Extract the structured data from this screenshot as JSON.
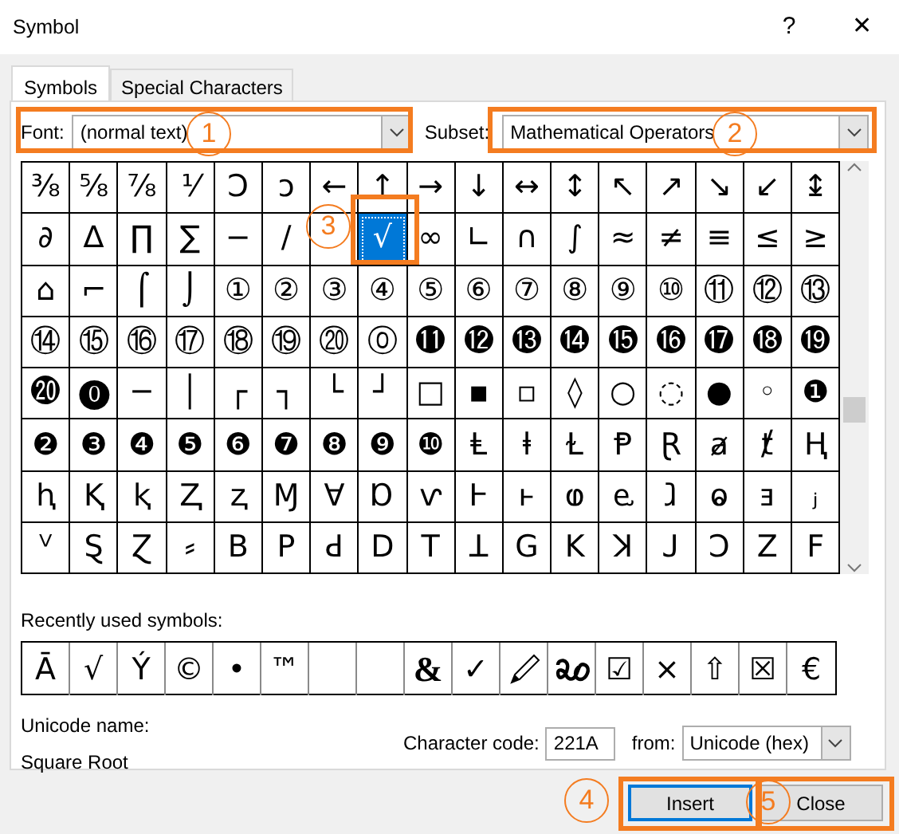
{
  "window": {
    "title": "Symbol",
    "help": "?",
    "close": "✕"
  },
  "tabs": [
    {
      "label": "Symbols",
      "selected": true
    },
    {
      "label": "Special Characters",
      "selected": false
    }
  ],
  "font": {
    "label": "Font:",
    "value": "(normal text)"
  },
  "subset": {
    "label": "Subset:",
    "value": "Mathematical Operators"
  },
  "grid": [
    [
      {
        "char": "⅜",
        "selected": false
      },
      {
        "char": "⅝",
        "selected": false
      },
      {
        "char": "⅞",
        "selected": false
      },
      {
        "char": "⅟",
        "selected": false
      },
      {
        "char": "Ↄ",
        "selected": false
      },
      {
        "char": "ↄ",
        "selected": false
      },
      {
        "char": "←",
        "selected": false
      },
      {
        "char": "↑",
        "selected": false
      },
      {
        "char": "→",
        "selected": false
      },
      {
        "char": "↓",
        "selected": false
      },
      {
        "char": "↔",
        "selected": false
      },
      {
        "char": "↕",
        "selected": false
      },
      {
        "char": "↖",
        "selected": false
      },
      {
        "char": "↗",
        "selected": false
      },
      {
        "char": "↘",
        "selected": false
      },
      {
        "char": "↙",
        "selected": false
      },
      {
        "char": "↨",
        "selected": false
      }
    ],
    [
      {
        "char": "∂",
        "selected": false
      },
      {
        "char": "∆",
        "selected": false
      },
      {
        "char": "∏",
        "selected": false
      },
      {
        "char": "∑",
        "selected": false
      },
      {
        "char": "−",
        "selected": false
      },
      {
        "char": "∕",
        "selected": false
      },
      {
        "selected": false
      },
      {
        "char": "√",
        "selected": true
      },
      {
        "char": "∞",
        "selected": false
      },
      {
        "char": "∟",
        "selected": false
      },
      {
        "char": "∩",
        "selected": false
      },
      {
        "char": "∫",
        "selected": false
      },
      {
        "char": "≈",
        "selected": false
      },
      {
        "char": "≠",
        "selected": false
      },
      {
        "char": "≡",
        "selected": false
      },
      {
        "char": "≤",
        "selected": false
      },
      {
        "char": "≥",
        "selected": false
      }
    ],
    [
      {
        "char": "⌂",
        "selected": false
      },
      {
        "char": "⌐",
        "selected": false
      },
      {
        "char": "⌠",
        "selected": false
      },
      {
        "char": "⌡",
        "selected": false
      },
      {
        "char": "①",
        "selected": false
      },
      {
        "char": "②",
        "selected": false
      },
      {
        "char": "③",
        "selected": false
      },
      {
        "char": "④",
        "selected": false
      },
      {
        "char": "⑤",
        "selected": false
      },
      {
        "char": "⑥",
        "selected": false
      },
      {
        "char": "⑦",
        "selected": false
      },
      {
        "char": "⑧",
        "selected": false
      },
      {
        "char": "⑨",
        "selected": false
      },
      {
        "char": "⑩",
        "selected": false
      },
      {
        "char": "⑪",
        "selected": false
      },
      {
        "char": "⑫",
        "selected": false
      },
      {
        "char": "⑬",
        "selected": false
      }
    ],
    [
      {
        "char": "⑭",
        "selected": false
      },
      {
        "char": "⑮",
        "selected": false
      },
      {
        "char": "⑯",
        "selected": false
      },
      {
        "char": "⑰",
        "selected": false
      },
      {
        "char": "⑱",
        "selected": false
      },
      {
        "char": "⑲",
        "selected": false
      },
      {
        "char": "⑳",
        "selected": false
      },
      {
        "char": "⓪",
        "selected": false
      },
      {
        "char": "⓫",
        "selected": false
      },
      {
        "char": "⓬",
        "selected": false
      },
      {
        "char": "⓭",
        "selected": false
      },
      {
        "char": "⓮",
        "selected": false
      },
      {
        "char": "⓯",
        "selected": false
      },
      {
        "char": "⓰",
        "selected": false
      },
      {
        "char": "⓱",
        "selected": false
      },
      {
        "char": "⓲",
        "selected": false
      },
      {
        "char": "⓳",
        "selected": false
      }
    ],
    [
      {
        "char": "⓴",
        "selected": false
      },
      {
        "char": "⓿",
        "selected": false
      },
      {
        "char": "─",
        "selected": false
      },
      {
        "char": "│",
        "selected": false
      },
      {
        "char": "┌",
        "selected": false
      },
      {
        "char": "┐",
        "selected": false
      },
      {
        "char": "└",
        "selected": false
      },
      {
        "char": "┘",
        "selected": false
      },
      {
        "char": "□",
        "selected": false
      },
      {
        "char": "▪",
        "selected": false
      },
      {
        "char": "▫",
        "selected": false
      },
      {
        "char": "◊",
        "selected": false
      },
      {
        "char": "○",
        "selected": false
      },
      {
        "char": "◌",
        "selected": false
      },
      {
        "char": "●",
        "selected": false
      },
      {
        "char": "◦",
        "selected": false
      },
      {
        "char": "❶",
        "selected": false
      }
    ],
    [
      {
        "char": "❷",
        "selected": false
      },
      {
        "char": "❸",
        "selected": false
      },
      {
        "char": "❹",
        "selected": false
      },
      {
        "char": "❺",
        "selected": false
      },
      {
        "char": "❻",
        "selected": false
      },
      {
        "char": "❼",
        "selected": false
      },
      {
        "char": "❽",
        "selected": false
      },
      {
        "char": "❾",
        "selected": false
      },
      {
        "char": "❿",
        "selected": false
      },
      {
        "char": "Ⱡ",
        "selected": false
      },
      {
        "char": "ⱡ",
        "selected": false
      },
      {
        "char": "Ɫ",
        "selected": false
      },
      {
        "char": "Ᵽ",
        "selected": false
      },
      {
        "char": "Ɽ",
        "selected": false
      },
      {
        "char": "ⱥ",
        "selected": false
      },
      {
        "char": "ⱦ",
        "selected": false
      },
      {
        "char": "Ⱨ",
        "selected": false
      }
    ],
    [
      {
        "char": "ⱨ",
        "selected": false
      },
      {
        "char": "Ⱪ",
        "selected": false
      },
      {
        "char": "ⱪ",
        "selected": false
      },
      {
        "char": "Ⱬ",
        "selected": false
      },
      {
        "char": "ⱬ",
        "selected": false
      },
      {
        "char": "Ɱ",
        "selected": false
      },
      {
        "char": "Ɐ",
        "selected": false
      },
      {
        "char": "Ɒ",
        "selected": false
      },
      {
        "char": "ⱱ",
        "selected": false
      },
      {
        "char": "Ⱶ",
        "selected": false
      },
      {
        "char": "ⱶ",
        "selected": false
      },
      {
        "char": "ⱷ",
        "selected": false
      },
      {
        "char": "ⱸ",
        "selected": false
      },
      {
        "char": "ⱹ",
        "selected": false
      },
      {
        "char": "ⱺ",
        "selected": false
      },
      {
        "char": "ⱻ",
        "selected": false
      },
      {
        "char": "ⱼ",
        "selected": false
      }
    ],
    [
      {
        "char": "ⱽ",
        "selected": false
      },
      {
        "char": "Ȿ",
        "selected": false
      },
      {
        "char": "Ɀ",
        "selected": false
      },
      {
        "char": "⸗",
        "selected": false
      },
      {
        "char": "ꓐ",
        "selected": false
      },
      {
        "char": "ꓑ",
        "selected": false
      },
      {
        "char": "ꓒ",
        "selected": false
      },
      {
        "char": "ꓓ",
        "selected": false
      },
      {
        "char": "ꓔ",
        "selected": false
      },
      {
        "char": "ꓕ",
        "selected": false
      },
      {
        "char": "ꓖ",
        "selected": false
      },
      {
        "char": "ꓗ",
        "selected": false
      },
      {
        "char": "ꓘ",
        "selected": false
      },
      {
        "char": "ꓙ",
        "selected": false
      },
      {
        "char": "ꓛ",
        "selected": false
      },
      {
        "char": "ꓜ",
        "selected": false
      },
      {
        "char": "ꓝ",
        "selected": false
      }
    ]
  ],
  "recent": {
    "label": "Recently used symbols:",
    "items": [
      {
        "kind": "text",
        "char": "Ā"
      },
      {
        "kind": "text",
        "char": "√"
      },
      {
        "kind": "text",
        "char": "Ý"
      },
      {
        "kind": "text",
        "char": "©"
      },
      {
        "kind": "text",
        "char": "•"
      },
      {
        "kind": "text",
        "char": "™"
      },
      {
        "kind": "blank"
      },
      {
        "kind": "blank"
      },
      {
        "kind": "bold",
        "char": "&"
      },
      {
        "kind": "text",
        "char": "✓"
      },
      {
        "kind": "pen"
      },
      {
        "kind": "ornament"
      },
      {
        "kind": "text",
        "char": "☑"
      },
      {
        "kind": "text",
        "char": "×"
      },
      {
        "kind": "text",
        "char": "⇧"
      },
      {
        "kind": "text",
        "char": "☒"
      },
      {
        "kind": "text",
        "char": "€"
      }
    ]
  },
  "unicode_name": {
    "label": "Unicode name:",
    "value": "Square Root"
  },
  "character_code": {
    "label": "Character code:",
    "value": "221A"
  },
  "from": {
    "label": "from:",
    "value": "Unicode (hex)"
  },
  "buttons": [
    {
      "label": "Insert",
      "default": true
    },
    {
      "label": "Close",
      "default": false
    }
  ],
  "callouts": [
    "1",
    "2",
    "3",
    "4",
    "5"
  ]
}
